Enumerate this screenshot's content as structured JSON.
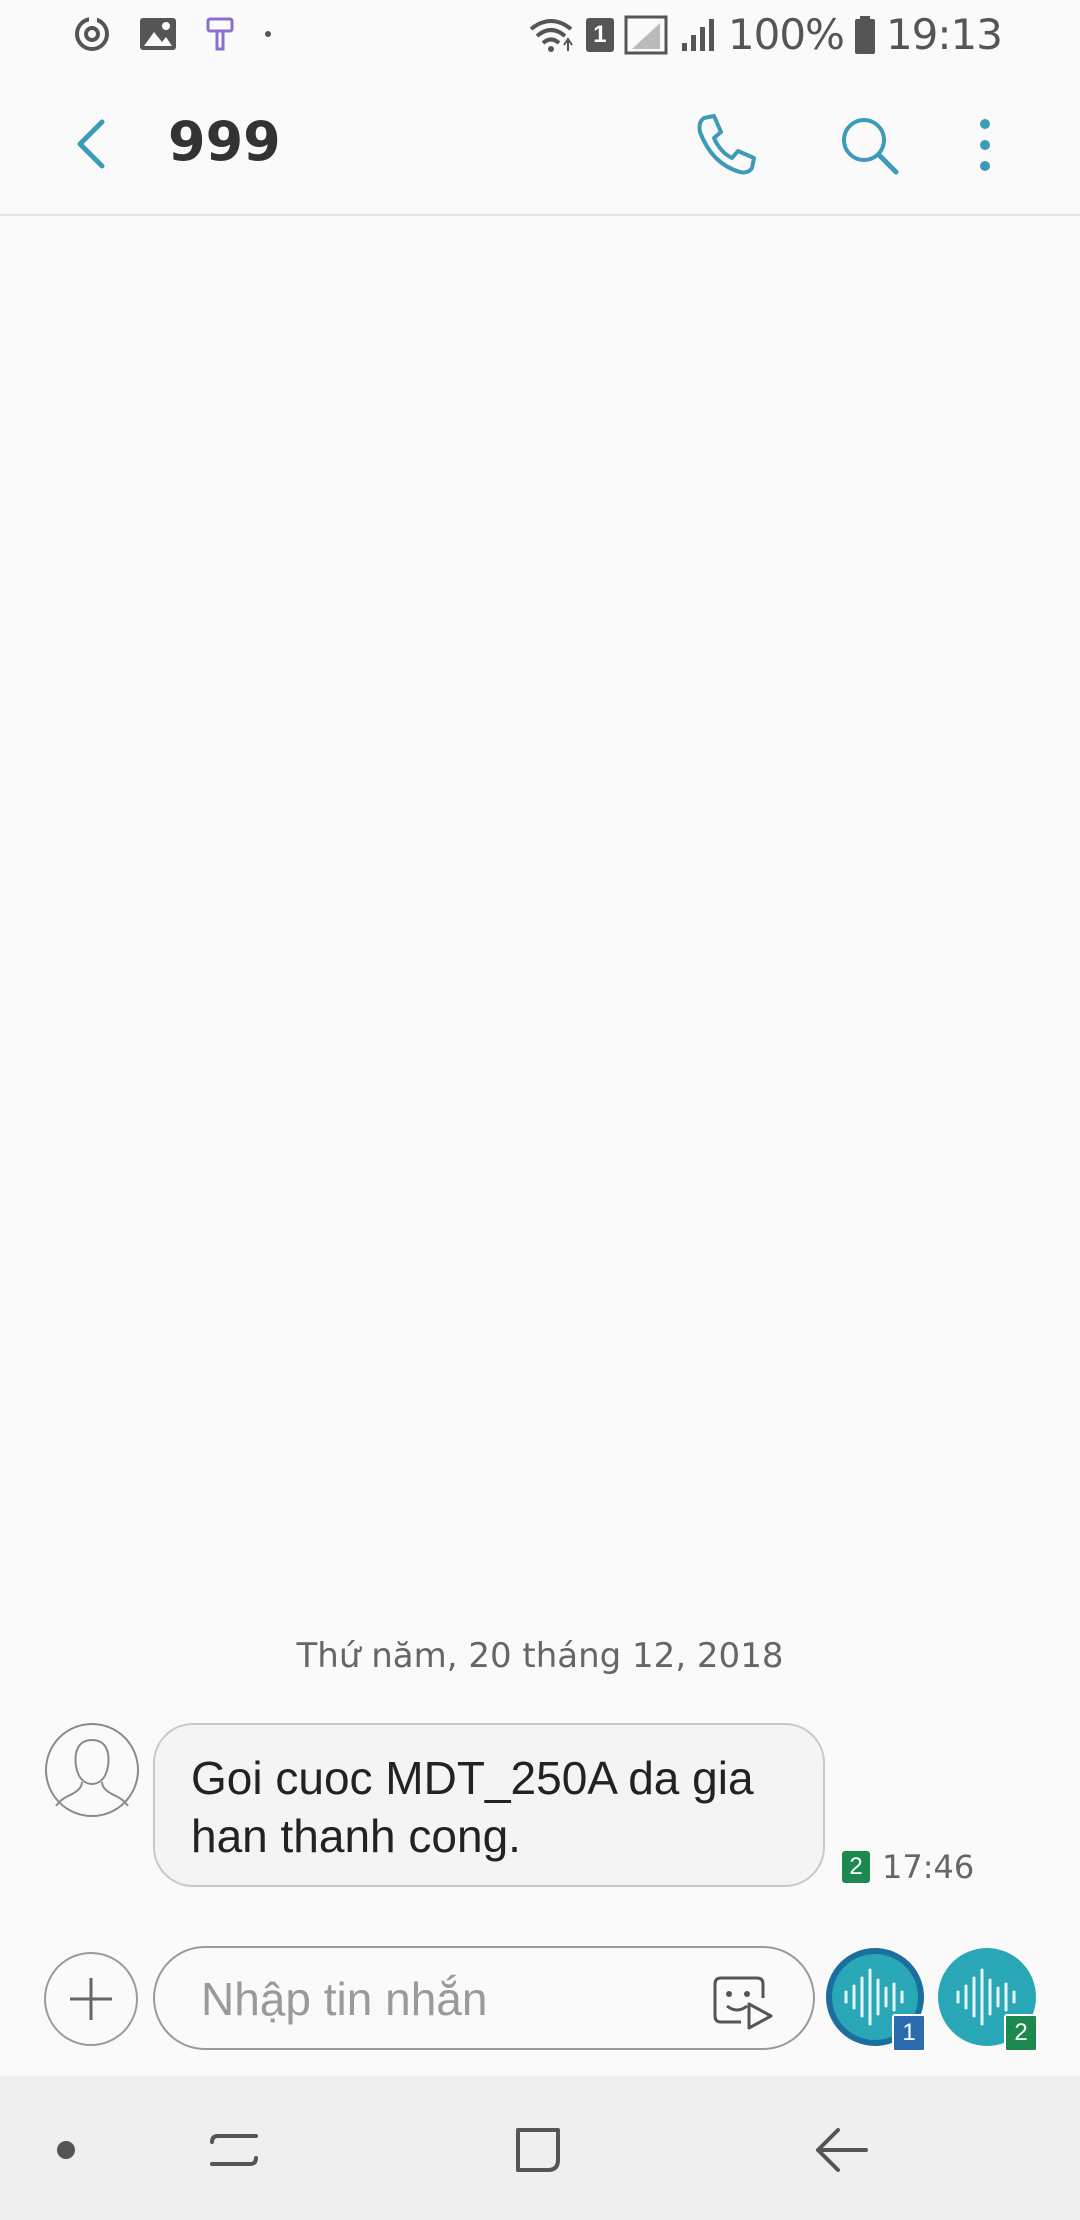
{
  "status_bar": {
    "battery": "100%",
    "time": "19:13",
    "sim_slot": "1",
    "icons": [
      "sync-icon",
      "image-icon",
      "paint-icon",
      "dot-icon",
      "wifi-icon",
      "signal-icon",
      "battery-icon"
    ]
  },
  "app_bar": {
    "title": "999",
    "icons": [
      "back-arrow-icon",
      "phone-icon",
      "search-icon",
      "more-vertical-icon"
    ]
  },
  "conversation": {
    "date_separator": "Thứ năm, 20 tháng 12, 2018",
    "messages": [
      {
        "text": "Goi cuoc MDT_250A da gia han thanh cong.",
        "sim": "2",
        "time": "17:46"
      }
    ]
  },
  "compose": {
    "placeholder": "Nhập tin nhắn",
    "value": "",
    "send_buttons": [
      {
        "sim": "1",
        "color": "#2a6cae"
      },
      {
        "sim": "2",
        "color": "#1c8a4e"
      }
    ]
  },
  "colors": {
    "accent": "#3d9bb8",
    "send_button": "#29a7b6",
    "background": "#fafafa"
  }
}
